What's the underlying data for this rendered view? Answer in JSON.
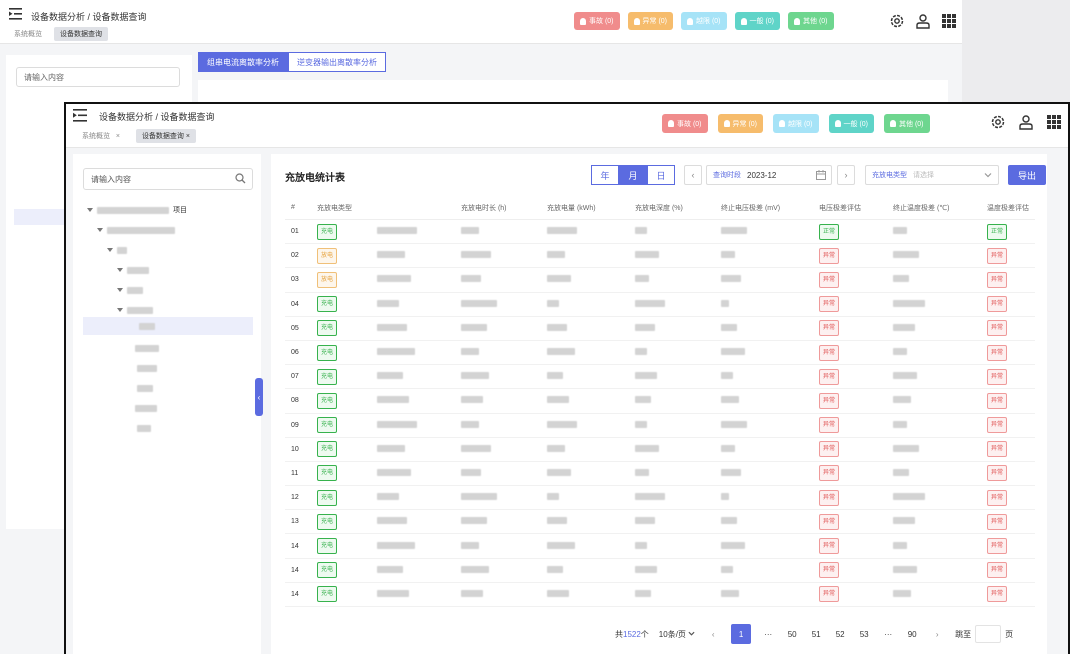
{
  "background_window": {
    "breadcrumb": "设备数据分析 / 设备数据查询",
    "tabs": [
      "系统概览",
      "设备数据查询"
    ],
    "badges": [
      "事故 (0)",
      "异常 (0)",
      "越限 (0)",
      "一般 (0)",
      "其他 (0)"
    ],
    "search_placeholder": "请输入内容",
    "segment_tabs": [
      "组串电流离散率分析",
      "逆变器输出离散率分析"
    ]
  },
  "header": {
    "breadcrumb": "设备数据分析 / 设备数据查询",
    "tabs": [
      {
        "label": "系统概览",
        "close": "×"
      },
      {
        "label": "设备数据查询",
        "close": "×"
      }
    ],
    "badges": [
      {
        "label": "事故 (0)",
        "color": "#f08c8c"
      },
      {
        "label": "异常 (0)",
        "color": "#f6bc6c"
      },
      {
        "label": "越限 (0)",
        "color": "#a6e3f7"
      },
      {
        "label": "一般 (0)",
        "color": "#5fd4c8"
      },
      {
        "label": "其他 (0)",
        "color": "#6ed68f"
      }
    ],
    "icons": [
      "gear-icon",
      "user-icon",
      "apps-grid-icon"
    ]
  },
  "sidebar": {
    "search_placeholder": "请输入内容",
    "tree_partial_text": "项目"
  },
  "main": {
    "title": "充放电统计表",
    "period_options": [
      "年",
      "月",
      "日"
    ],
    "period_selected": "月",
    "date_label": "查询时段",
    "date_value": "2023-12",
    "type_label": "充放电类型",
    "type_placeholder": "请选择",
    "export_label": "导出",
    "accent_color": "#5b6be0",
    "table": {
      "headers": [
        "#",
        "充放电类型",
        "",
        "充放电时长 (h)",
        "充放电量 (kWh)",
        "充放电深度 (%)",
        "终止电压极差 (mV)",
        "电压极差评估",
        "终止温度极差 (℃)",
        "温度极差评估"
      ],
      "rows": [
        {
          "no": "01",
          "type": "充电",
          "type_color": "green",
          "volt_eval": "正常",
          "volt_color": "green",
          "temp_eval": "正常",
          "temp_color": "green"
        },
        {
          "no": "02",
          "type": "放电",
          "type_color": "orange",
          "volt_eval": "异常",
          "volt_color": "red",
          "temp_eval": "异常",
          "temp_color": "red"
        },
        {
          "no": "03",
          "type": "放电",
          "type_color": "orange",
          "volt_eval": "异常",
          "volt_color": "red",
          "temp_eval": "异常",
          "temp_color": "red"
        },
        {
          "no": "04",
          "type": "充电",
          "type_color": "green",
          "volt_eval": "异常",
          "volt_color": "red",
          "temp_eval": "异常",
          "temp_color": "red"
        },
        {
          "no": "05",
          "type": "充电",
          "type_color": "green",
          "volt_eval": "异常",
          "volt_color": "red",
          "temp_eval": "异常",
          "temp_color": "red"
        },
        {
          "no": "06",
          "type": "充电",
          "type_color": "green",
          "volt_eval": "异常",
          "volt_color": "red",
          "temp_eval": "异常",
          "temp_color": "red"
        },
        {
          "no": "07",
          "type": "充电",
          "type_color": "green",
          "volt_eval": "异常",
          "volt_color": "red",
          "temp_eval": "异常",
          "temp_color": "red"
        },
        {
          "no": "08",
          "type": "充电",
          "type_color": "green",
          "volt_eval": "异常",
          "volt_color": "red",
          "temp_eval": "异常",
          "temp_color": "red"
        },
        {
          "no": "09",
          "type": "充电",
          "type_color": "green",
          "volt_eval": "异常",
          "volt_color": "red",
          "temp_eval": "异常",
          "temp_color": "red"
        },
        {
          "no": "10",
          "type": "充电",
          "type_color": "green",
          "volt_eval": "异常",
          "volt_color": "red",
          "temp_eval": "异常",
          "temp_color": "red"
        },
        {
          "no": "11",
          "type": "充电",
          "type_color": "green",
          "volt_eval": "异常",
          "volt_color": "red",
          "temp_eval": "异常",
          "temp_color": "red"
        },
        {
          "no": "12",
          "type": "充电",
          "type_color": "green",
          "volt_eval": "异常",
          "volt_color": "red",
          "temp_eval": "异常",
          "temp_color": "red"
        },
        {
          "no": "13",
          "type": "充电",
          "type_color": "green",
          "volt_eval": "异常",
          "volt_color": "red",
          "temp_eval": "异常",
          "temp_color": "red"
        },
        {
          "no": "14",
          "type": "充电",
          "type_color": "green",
          "volt_eval": "异常",
          "volt_color": "red",
          "temp_eval": "异常",
          "temp_color": "red"
        },
        {
          "no": "14",
          "type": "充电",
          "type_color": "green",
          "volt_eval": "异常",
          "volt_color": "red",
          "temp_eval": "异常",
          "temp_color": "red"
        },
        {
          "no": "14",
          "type": "充电",
          "type_color": "green",
          "volt_eval": "异常",
          "volt_color": "red",
          "temp_eval": "异常",
          "temp_color": "red"
        }
      ]
    },
    "pagination": {
      "total_prefix": "共",
      "total_count": "1522",
      "total_suffix": "个",
      "page_size": "10条/页",
      "pages": [
        "1",
        "···",
        "50",
        "51",
        "52",
        "53",
        "···",
        "90"
      ],
      "current": "1",
      "jump_label": "跳至",
      "jump_suffix": "页"
    }
  }
}
